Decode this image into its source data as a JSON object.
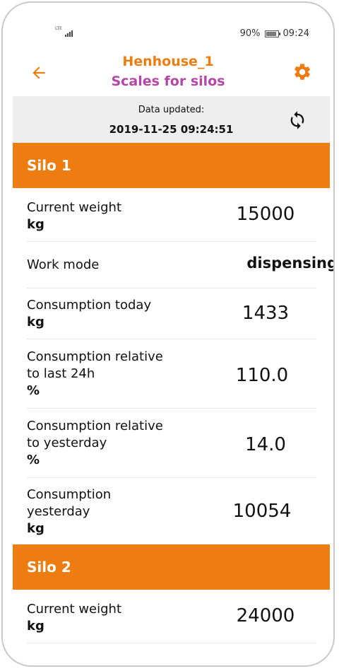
{
  "status_bar": {
    "network": "LTE",
    "battery_percent": "90%",
    "time": "09:24",
    "battery_level": 0.9
  },
  "header": {
    "title": "Henhouse_1",
    "subtitle": "Scales for silos"
  },
  "data_updated": {
    "label": "Data updated:",
    "timestamp": "2019-11-25 09:24:51"
  },
  "silos": [
    {
      "name": "Silo 1",
      "rows": [
        {
          "label_lines": [
            "Current weight"
          ],
          "unit": "kg",
          "value": "15000"
        },
        {
          "label_lines": [
            "Work mode"
          ],
          "unit": "",
          "value": "dispensing"
        },
        {
          "label_lines": [
            "Consumption today"
          ],
          "unit": "kg",
          "value": "1433"
        },
        {
          "label_lines": [
            "Consumption relative",
            "to last 24h"
          ],
          "unit": "%",
          "value": "110.0"
        },
        {
          "label_lines": [
            "Consumption relative",
            "to yesterday"
          ],
          "unit": "%",
          "value": "14.0"
        },
        {
          "label_lines": [
            "Consumption",
            "yesterday"
          ],
          "unit": "kg",
          "value": "10054"
        }
      ]
    },
    {
      "name": "Silo 2",
      "rows": [
        {
          "label_lines": [
            "Current weight"
          ],
          "unit": "kg",
          "value": "24000"
        }
      ]
    }
  ],
  "colors": {
    "accent_orange": "#ee7d11",
    "subtitle_purple": "#b347a6",
    "panel_gray": "#eeeeee"
  },
  "icons": {
    "back": "arrow-left-icon",
    "settings": "gear-icon",
    "refresh": "refresh-icon"
  }
}
